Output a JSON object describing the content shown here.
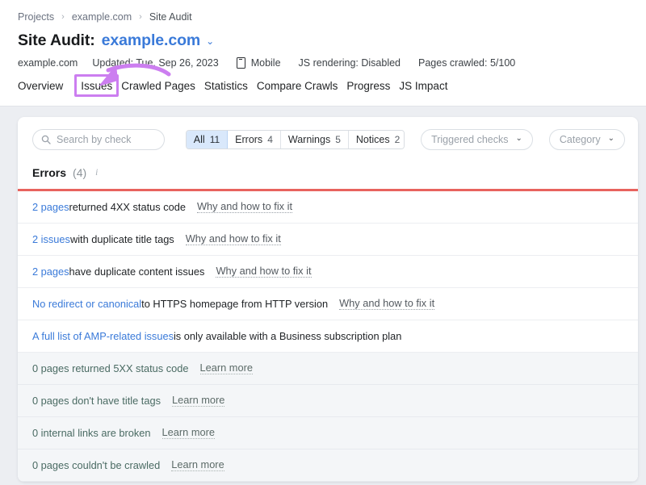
{
  "breadcrumb": {
    "items": [
      {
        "label": "Projects",
        "type": "link"
      },
      {
        "label": "example.com",
        "type": "link"
      },
      {
        "label": "Site Audit",
        "type": "current"
      }
    ],
    "separator": "›"
  },
  "title": {
    "static": "Site Audit:",
    "domain": "example.com",
    "caret": "⌄"
  },
  "meta": {
    "domain": "example.com",
    "updated": "Updated: Tue, Sep 26, 2023",
    "device": "Mobile",
    "js_rendering": "JS rendering: Disabled",
    "pages_crawled": "Pages crawled: 5/100"
  },
  "tabs": [
    {
      "label": "Overview",
      "active": false,
      "highlighted": false
    },
    {
      "label": "Issues",
      "active": true,
      "highlighted": true
    },
    {
      "label": "Crawled Pages",
      "active": false,
      "highlighted": false
    },
    {
      "label": "Statistics",
      "active": false,
      "highlighted": false
    },
    {
      "label": "Compare Crawls",
      "active": false,
      "highlighted": false
    },
    {
      "label": "Progress",
      "active": false,
      "highlighted": false
    },
    {
      "label": "JS Impact",
      "active": false,
      "highlighted": false
    }
  ],
  "annotation": {
    "color": "#cc7ef0",
    "shape": "curved-arrow-pointing-to-issues-tab"
  },
  "filters": {
    "search": {
      "value": "",
      "placeholder": "Search by check"
    },
    "segments": [
      {
        "label": "All",
        "count": "11",
        "active": true
      },
      {
        "label": "Errors",
        "count": "4",
        "active": false
      },
      {
        "label": "Warnings",
        "count": "5",
        "active": false
      },
      {
        "label": "Notices",
        "count": "2",
        "active": false
      }
    ],
    "dropdowns": [
      {
        "label": "Triggered checks",
        "caret": "⌄"
      },
      {
        "label": "Category",
        "caret": "⌄"
      }
    ]
  },
  "section": {
    "title": "Errors",
    "count": "(4)",
    "info_icon": "i",
    "rule_color": "#e8635e"
  },
  "issues": [
    {
      "link": "2 pages",
      "text": " returned 4XX status code",
      "action": "Why and how to fix it",
      "zero": false
    },
    {
      "link": "2 issues",
      "text": " with duplicate title tags",
      "action": "Why and how to fix it",
      "zero": false
    },
    {
      "link": "2 pages",
      "text": " have duplicate content issues",
      "action": "Why and how to fix it",
      "zero": false
    },
    {
      "link": "No redirect or canonical",
      "text": " to HTTPS homepage from HTTP version",
      "action": "Why and how to fix it",
      "zero": false
    },
    {
      "link": "A full list of AMP-related issues",
      "text": " is only available with a Business subscription plan",
      "action": "",
      "zero": false
    },
    {
      "link": "0 pages returned 5XX status code",
      "text": "",
      "action": "Learn more",
      "zero": true
    },
    {
      "link": "0 pages don't have title tags",
      "text": "",
      "action": "Learn more",
      "zero": true
    },
    {
      "link": "0 internal links are broken",
      "text": "",
      "action": "Learn more",
      "zero": true
    },
    {
      "link": "0 pages couldn't be crawled",
      "text": "",
      "action": "Learn more",
      "zero": true
    }
  ],
  "colors": {
    "accent_link": "#3a7ad9",
    "error_rule": "#e8635e",
    "annotation_purple": "#cc7ef0",
    "page_background": "#eceef2",
    "zero_row_background": "#f4f6f8"
  }
}
